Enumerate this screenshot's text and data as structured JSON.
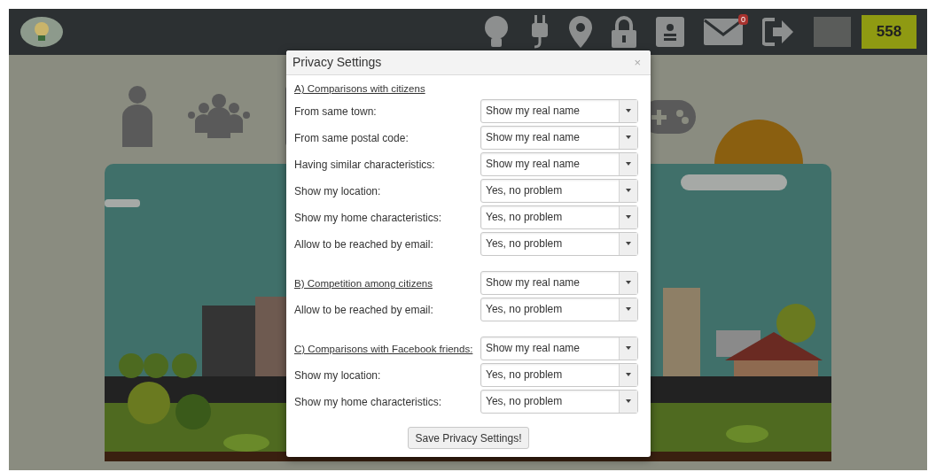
{
  "nav": {
    "mail_badge": "0",
    "score": "558"
  },
  "dialog": {
    "title": "Privacy Settings",
    "close": "×",
    "sections": [
      {
        "heading": "A) Comparisons with citizens",
        "fields": [
          {
            "label": "From same town:",
            "value": "Show my real name"
          },
          {
            "label": "From same postal code:",
            "value": "Show my real name"
          },
          {
            "label": "Having similar characteristics:",
            "value": "Show my real name"
          },
          {
            "label": "Show my location:",
            "value": "Yes, no problem"
          },
          {
            "label": "Show my home characteristics:",
            "value": "Yes, no problem"
          },
          {
            "label": "Allow to be reached by email:",
            "value": "Yes, no problem"
          }
        ]
      },
      {
        "heading": "B) Competition among citizens",
        "heading_value": "Show my real name",
        "fields": [
          {
            "label": "Allow to be reached by email:",
            "value": "Yes, no problem"
          }
        ]
      },
      {
        "heading": "C) Comparisons with Facebook friends:",
        "heading_value": "Show my real name",
        "fields": [
          {
            "label": "Show my location:",
            "value": "Yes, no problem"
          },
          {
            "label": "Show my home characteristics:",
            "value": "Yes, no problem"
          }
        ]
      }
    ],
    "save_button": "Save Privacy Settings!"
  }
}
